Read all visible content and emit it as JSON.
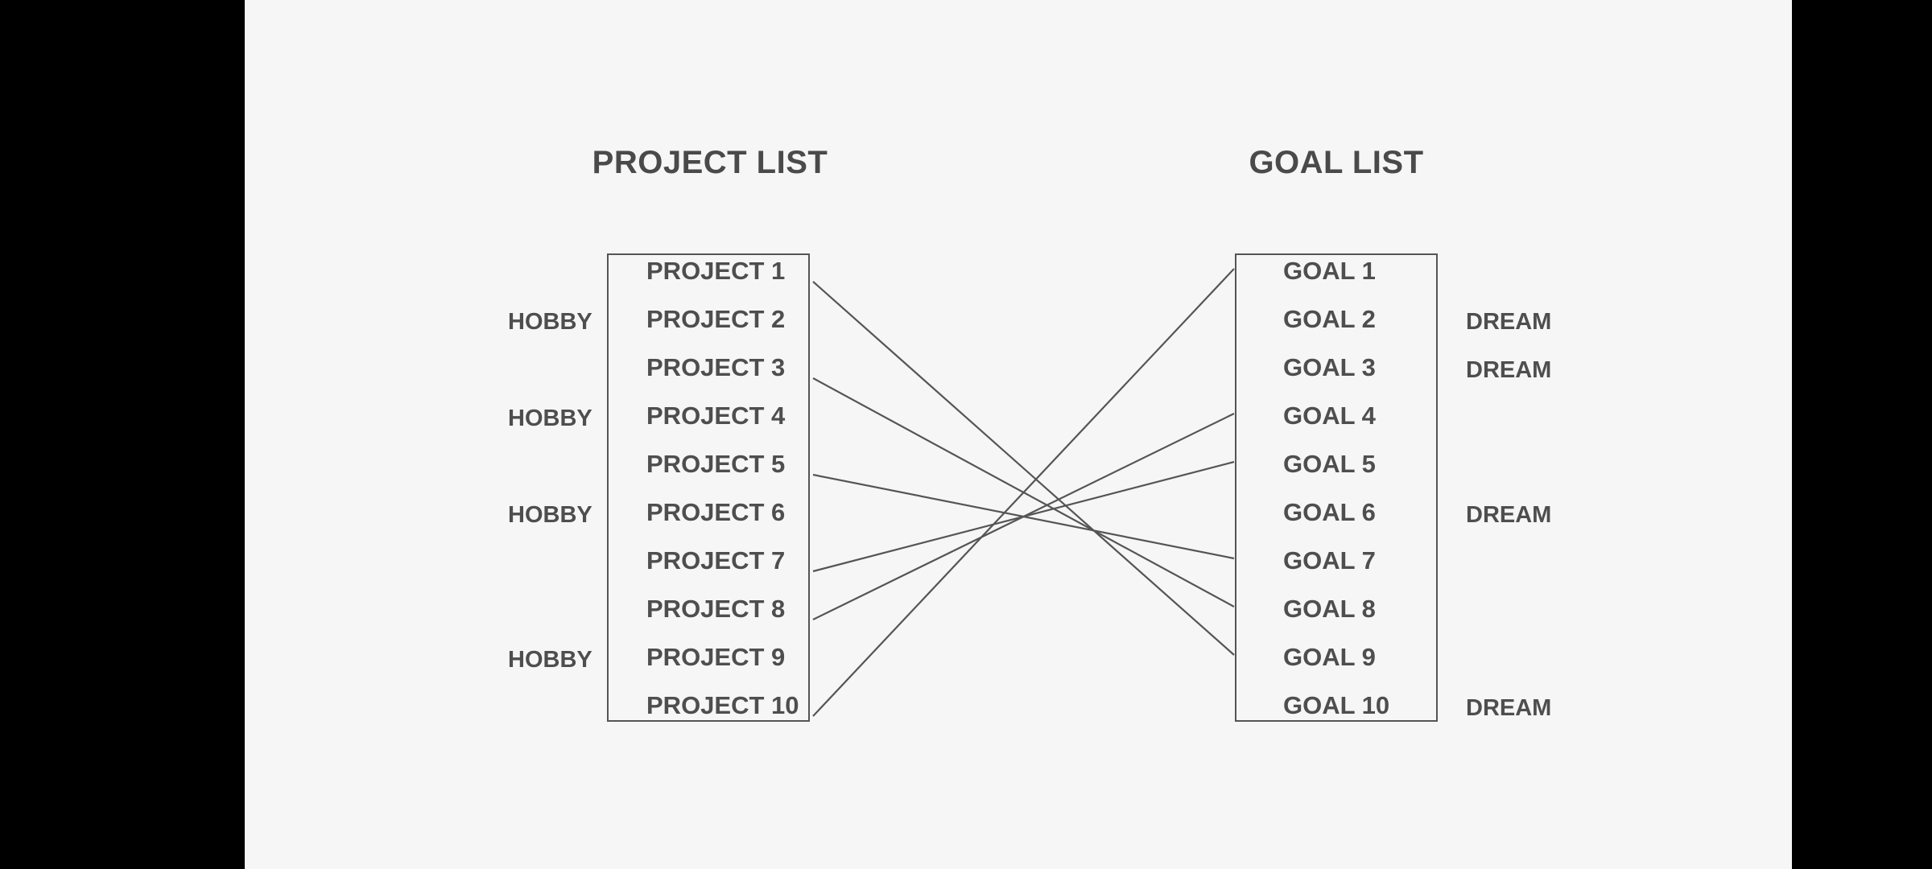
{
  "project_list": {
    "title": "PROJECT LIST",
    "items": [
      "PROJECT 1",
      "PROJECT 2",
      "PROJECT 3",
      "PROJECT 4",
      "PROJECT 5",
      "PROJECT 6",
      "PROJECT 7",
      "PROJECT 8",
      "PROJECT 9",
      "PROJECT 10"
    ],
    "tags": [
      "",
      "HOBBY",
      "",
      "HOBBY",
      "",
      "HOBBY",
      "",
      "",
      "HOBBY",
      ""
    ]
  },
  "goal_list": {
    "title": "GOAL LIST",
    "items": [
      "GOAL 1",
      "GOAL 2",
      "GOAL 3",
      "GOAL 4",
      "GOAL 5",
      "GOAL 6",
      "GOAL 7",
      "GOAL 8",
      "GOAL 9",
      "GOAL 10"
    ],
    "tags": [
      "",
      "DREAM",
      "DREAM",
      "",
      "",
      "DREAM",
      "",
      "",
      "",
      "DREAM"
    ]
  },
  "links": [
    {
      "project": "PROJECT 1",
      "goal": "GOAL 9"
    },
    {
      "project": "PROJECT 3",
      "goal": "GOAL 8"
    },
    {
      "project": "PROJECT 5",
      "goal": "GOAL 7"
    },
    {
      "project": "PROJECT 7",
      "goal": "GOAL 5"
    },
    {
      "project": "PROJECT 8",
      "goal": "GOAL 4"
    },
    {
      "project": "PROJECT 10",
      "goal": "GOAL 1"
    }
  ],
  "colors": {
    "background": "#f6f6f6",
    "letterbox": "#000000",
    "text": "#4e4e4e",
    "line": "#555555"
  }
}
